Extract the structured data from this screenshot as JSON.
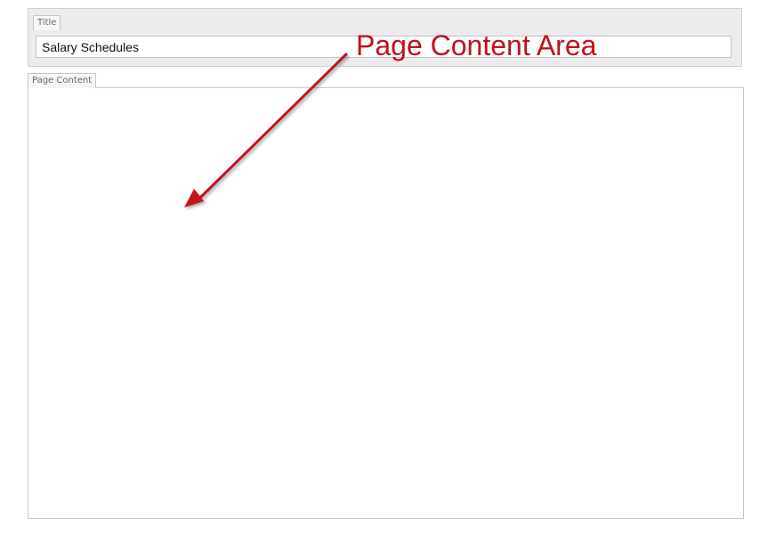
{
  "title_panel": {
    "tab_label": "Title",
    "value": "Salary Schedules"
  },
  "content_panel": {
    "tab_label": "Page Content"
  },
  "annotation": {
    "text": "Page Content Area",
    "color": "#c0121c",
    "icon": "arrow-icon"
  }
}
